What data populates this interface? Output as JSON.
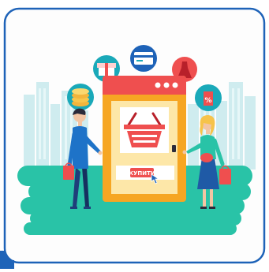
{
  "scene": {
    "buy_button_label": "КУПИТИ"
  },
  "colors": {
    "frame_blue": "#1e63b8",
    "card_background": "#fdfdfd",
    "city_silhouette": "#cfecef",
    "ground_teal": "#29c3a7",
    "device_orange": "#f6a623",
    "device_yellow": "#fde7a8",
    "basket_red": "#ef4f4f",
    "bubble_teal": "#1aa9b9",
    "man_shirt": "#1e73c8",
    "woman_dress": "#1f5aa6"
  },
  "icons": [
    "gift-icon",
    "credit-card-icon",
    "dress-icon",
    "coins-icon",
    "discount-tag-icon",
    "shopping-basket-icon",
    "hand-cursor-icon"
  ]
}
